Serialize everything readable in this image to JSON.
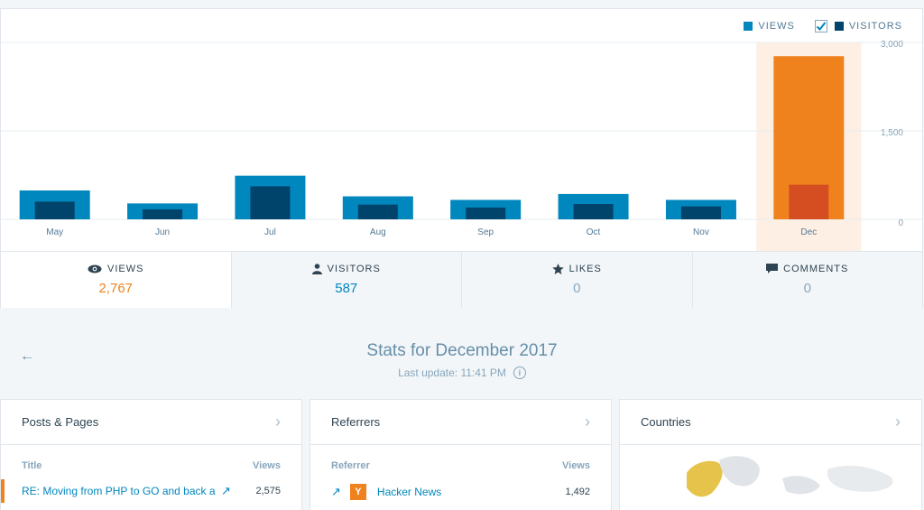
{
  "legend": {
    "views": "VIEWS",
    "visitors": "VISITORS"
  },
  "colors": {
    "views": "#0087be",
    "visitors": "#00436b",
    "highlight": "#f0821e",
    "highlight_dark": "#d54e21",
    "highlight_bg": "#fdefe3"
  },
  "chart_data": {
    "type": "bar",
    "categories": [
      "May",
      "Jun",
      "Jul",
      "Aug",
      "Sep",
      "Oct",
      "Nov",
      "Dec"
    ],
    "series": [
      {
        "name": "VIEWS",
        "values": [
          490,
          270,
          740,
          390,
          330,
          430,
          330,
          2767
        ]
      },
      {
        "name": "VISITORS",
        "values": [
          300,
          170,
          560,
          250,
          200,
          260,
          220,
          587
        ]
      }
    ],
    "yticks": [
      "3,000",
      "1,500",
      "0"
    ],
    "ylim": [
      0,
      3000
    ],
    "highlighted_category": "Dec",
    "grid": true
  },
  "tabs": [
    {
      "label": "VIEWS",
      "value": "2,767",
      "icon": "eye-icon"
    },
    {
      "label": "VISITORS",
      "value": "587",
      "icon": "person-icon"
    },
    {
      "label": "LIKES",
      "value": "0",
      "icon": "star-icon"
    },
    {
      "label": "COMMENTS",
      "value": "0",
      "icon": "comment-icon"
    }
  ],
  "stats": {
    "title": "Stats for December 2017",
    "last_update": "Last update: 11:41 PM"
  },
  "posts": {
    "title": "Posts & Pages",
    "col_title": "Title",
    "col_views": "Views",
    "rows": [
      {
        "title": "RE: Moving from PHP to GO and back ag",
        "views": "2,575"
      }
    ]
  },
  "referrers": {
    "title": "Referrers",
    "col_title": "Referrer",
    "col_views": "Views",
    "rows": [
      {
        "title": "Hacker News",
        "views": "1,492"
      }
    ]
  },
  "countries": {
    "title": "Countries"
  }
}
